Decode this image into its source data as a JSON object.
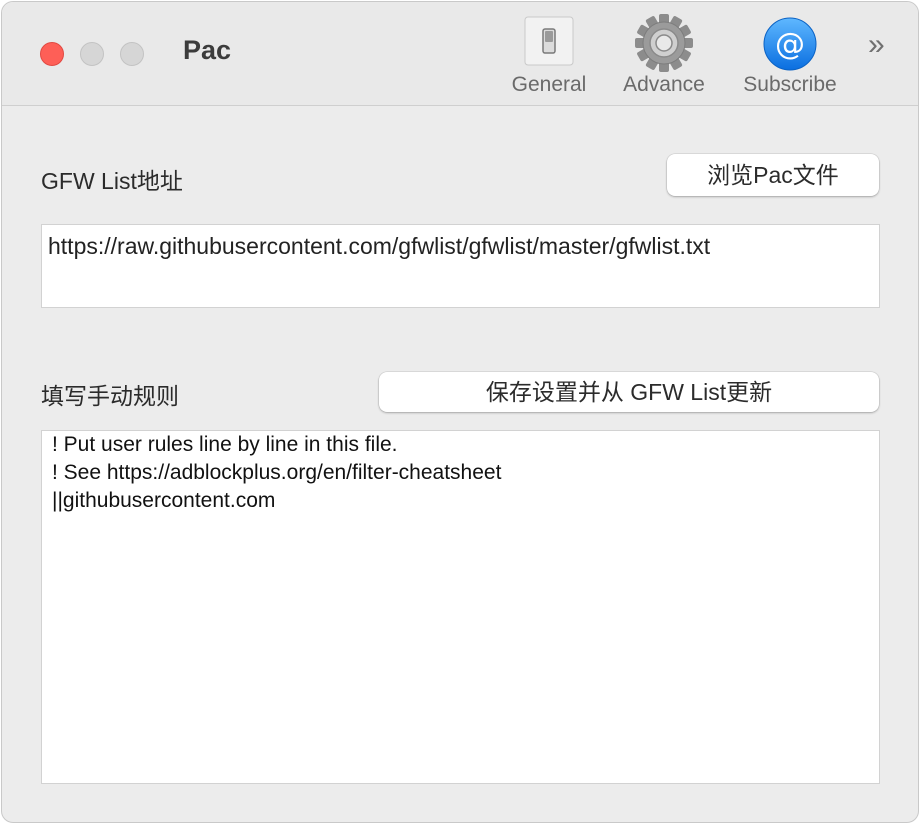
{
  "window": {
    "title": "Pac",
    "traffic_lights": {
      "close_color": "#fe5f57",
      "inactive_color": "#d6d6d6"
    }
  },
  "toolbar": {
    "items": [
      {
        "label": "General",
        "icon": "switch-icon"
      },
      {
        "label": "Advance",
        "icon": "gear-icon"
      },
      {
        "label": "Subscribe",
        "icon": "at-sign-icon",
        "icon_color": "#1a8cf0"
      }
    ],
    "overflow_glyph": "»"
  },
  "gfw": {
    "label": "GFW List地址",
    "browse_button": "浏览Pac文件",
    "url": "https://raw.githubusercontent.com/gfwlist/gfwlist/master/gfwlist.txt"
  },
  "rules": {
    "label": "填写手动规则",
    "save_button": "保存设置并从 GFW List更新",
    "lines": [
      "! Put user rules line by line in this file.",
      "! See https://adblockplus.org/en/filter-cheatsheet",
      "||githubusercontent.com"
    ]
  }
}
